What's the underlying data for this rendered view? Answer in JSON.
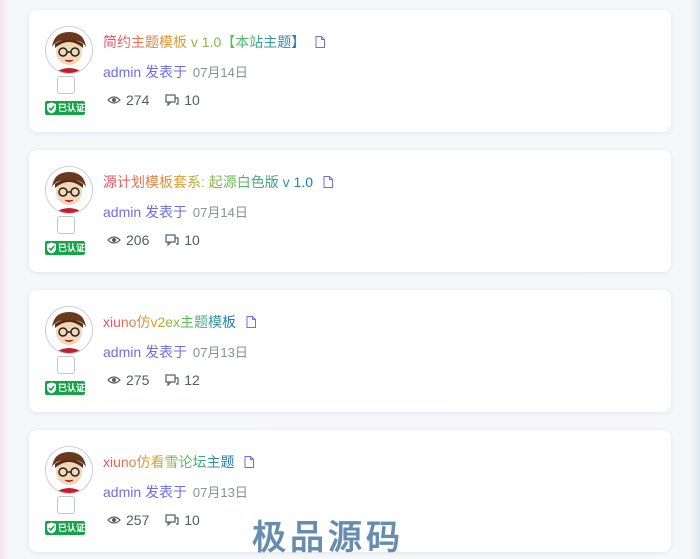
{
  "posts": [
    {
      "title": "简约主题模板 v 1.0【本站主题】",
      "author": "admin",
      "action": "发表于",
      "date": "07月14日",
      "views": "274",
      "replies": "10",
      "badge": "已认证"
    },
    {
      "title": "源计划模板套系: 起源白色版 v 1.0",
      "author": "admin",
      "action": "发表于",
      "date": "07月14日",
      "views": "206",
      "replies": "10",
      "badge": "已认证"
    },
    {
      "title": "xiuno仿v2ex主题模板",
      "author": "admin",
      "action": "发表于",
      "date": "07月13日",
      "views": "275",
      "replies": "12",
      "badge": "已认证"
    },
    {
      "title": "xiuno仿看雪论坛主题",
      "author": "admin",
      "action": "发表于",
      "date": "07月13日",
      "views": "257",
      "replies": "10",
      "badge": "已认证"
    }
  ],
  "watermark": "极品源码",
  "colors": {
    "author": "#6d6ee8",
    "badge": "#16a34a",
    "date": "#8a8f99"
  },
  "icons": {
    "view": "eye-icon",
    "reply": "comment-icon",
    "doc": "document-icon",
    "shield": "shield-check-icon"
  }
}
